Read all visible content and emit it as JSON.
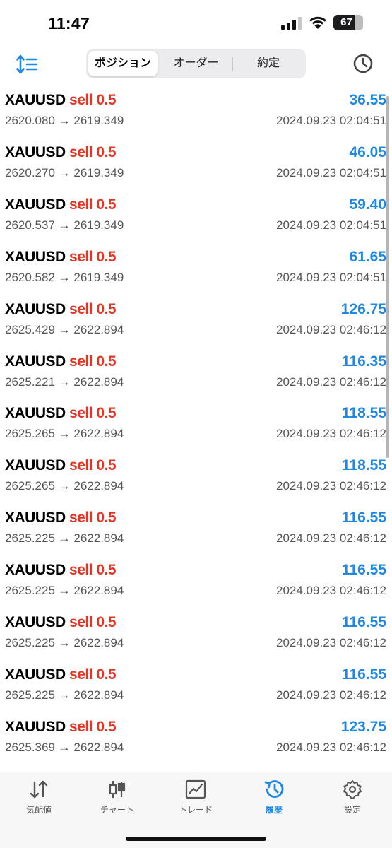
{
  "status_bar": {
    "time": "11:47",
    "battery": "67"
  },
  "top_nav": {
    "segments": [
      "ポジション",
      "オーダー",
      "約定"
    ],
    "selected_segment": "ポジション"
  },
  "rows": [
    {
      "symbol": "XAUUSD",
      "side": "sell",
      "volume": "0.5",
      "profit": "36.55",
      "open_price": "2620.080",
      "arrow": "→",
      "current_price": "2619.349",
      "time": "2024.09.23 02:04:51"
    },
    {
      "symbol": "XAUUSD",
      "side": "sell",
      "volume": "0.5",
      "profit": "46.05",
      "open_price": "2620.270",
      "arrow": "→",
      "current_price": "2619.349",
      "time": "2024.09.23 02:04:51"
    },
    {
      "symbol": "XAUUSD",
      "side": "sell",
      "volume": "0.5",
      "profit": "59.40",
      "open_price": "2620.537",
      "arrow": "→",
      "current_price": "2619.349",
      "time": "2024.09.23 02:04:51"
    },
    {
      "symbol": "XAUUSD",
      "side": "sell",
      "volume": "0.5",
      "profit": "61.65",
      "open_price": "2620.582",
      "arrow": "→",
      "current_price": "2619.349",
      "time": "2024.09.23 02:04:51"
    },
    {
      "symbol": "XAUUSD",
      "side": "sell",
      "volume": "0.5",
      "profit": "126.75",
      "open_price": "2625.429",
      "arrow": "→",
      "current_price": "2622.894",
      "time": "2024.09.23 02:46:12"
    },
    {
      "symbol": "XAUUSD",
      "side": "sell",
      "volume": "0.5",
      "profit": "116.35",
      "open_price": "2625.221",
      "arrow": "→",
      "current_price": "2622.894",
      "time": "2024.09.23 02:46:12"
    },
    {
      "symbol": "XAUUSD",
      "side": "sell",
      "volume": "0.5",
      "profit": "118.55",
      "open_price": "2625.265",
      "arrow": "→",
      "current_price": "2622.894",
      "time": "2024.09.23 02:46:12"
    },
    {
      "symbol": "XAUUSD",
      "side": "sell",
      "volume": "0.5",
      "profit": "118.55",
      "open_price": "2625.265",
      "arrow": "→",
      "current_price": "2622.894",
      "time": "2024.09.23 02:46:12"
    },
    {
      "symbol": "XAUUSD",
      "side": "sell",
      "volume": "0.5",
      "profit": "116.55",
      "open_price": "2625.225",
      "arrow": "→",
      "current_price": "2622.894",
      "time": "2024.09.23 02:46:12"
    },
    {
      "symbol": "XAUUSD",
      "side": "sell",
      "volume": "0.5",
      "profit": "116.55",
      "open_price": "2625.225",
      "arrow": "→",
      "current_price": "2622.894",
      "time": "2024.09.23 02:46:12"
    },
    {
      "symbol": "XAUUSD",
      "side": "sell",
      "volume": "0.5",
      "profit": "116.55",
      "open_price": "2625.225",
      "arrow": "→",
      "current_price": "2622.894",
      "time": "2024.09.23 02:46:12"
    },
    {
      "symbol": "XAUUSD",
      "side": "sell",
      "volume": "0.5",
      "profit": "116.55",
      "open_price": "2625.225",
      "arrow": "→",
      "current_price": "2622.894",
      "time": "2024.09.23 02:46:12"
    },
    {
      "symbol": "XAUUSD",
      "side": "sell",
      "volume": "0.5",
      "profit": "123.75",
      "open_price": "2625.369",
      "arrow": "→",
      "current_price": "2622.894",
      "time": "2024.09.23 02:46:12"
    }
  ],
  "tab_bar": {
    "tabs": [
      {
        "label": "気配値",
        "icon": "updown-arrows-icon"
      },
      {
        "label": "チャート",
        "icon": "candlestick-icon"
      },
      {
        "label": "トレード",
        "icon": "trade-chart-icon"
      },
      {
        "label": "履歴",
        "icon": "history-icon"
      },
      {
        "label": "設定",
        "icon": "gear-icon"
      }
    ],
    "active_tab": "履歴"
  },
  "colors": {
    "accent": "#1e88e5",
    "sell": "#e53525",
    "profit": "#1e88e5"
  }
}
